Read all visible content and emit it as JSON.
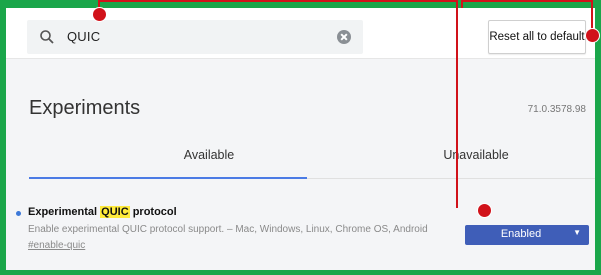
{
  "search": {
    "value": "QUIC"
  },
  "toolbar": {
    "reset_label": "Reset all to default"
  },
  "page": {
    "title": "Experiments",
    "version": "71.0.3578.98"
  },
  "tabs": [
    {
      "label": "Available",
      "active": true
    },
    {
      "label": "Unavailable",
      "active": false
    }
  ],
  "experiment": {
    "title_prefix": "Experimental ",
    "title_highlight": "QUIC",
    "title_suffix": " protocol",
    "description": "Enable experimental QUIC protocol support. – Mac, Windows, Linux, Chrome OS, Android",
    "link": "#enable-quic",
    "state": "Enabled"
  },
  "colors": {
    "background_green": "#1aa64a",
    "annotation_red": "#d1121a",
    "accent_blue": "#4b7be5",
    "button_blue": "#3f5eb8",
    "highlight_yellow": "#ffeb3b"
  },
  "icons": [
    "search-icon",
    "clear-icon",
    "caret-down-icon",
    "bullet-dot-icon"
  ]
}
